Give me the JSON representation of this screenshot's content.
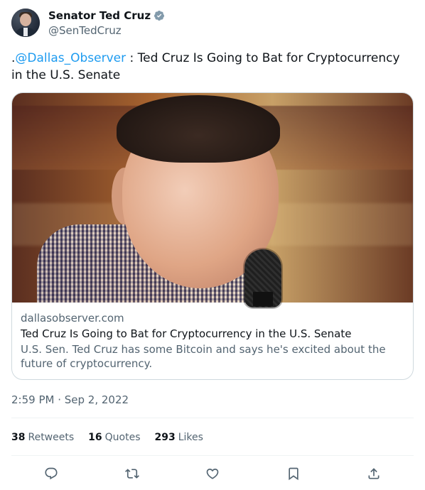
{
  "author": {
    "display_name": "Senator Ted Cruz",
    "handle": "@SenTedCruz",
    "verified_icon": "verified-badge"
  },
  "tweet": {
    "text_prefix": ".",
    "mention": "@Dallas_Observer",
    "text_rest": " : Ted Cruz Is Going to Bat for Cryptocurrency in the U.S. Senate"
  },
  "card": {
    "domain": "dallasobserver.com",
    "title": "Ted Cruz Is Going to Bat for Cryptocurrency in the U.S. Senate",
    "description": "U.S. Sen. Ted Cruz has some Bitcoin and says he's excited about the future of cryptocurrency."
  },
  "timestamp": "2:59 PM · Sep 2, 2022",
  "stats": {
    "retweets_count": "38",
    "retweets_label": "Retweets",
    "quotes_count": "16",
    "quotes_label": "Quotes",
    "likes_count": "293",
    "likes_label": "Likes"
  },
  "actions": [
    "reply-icon",
    "retweet-icon",
    "like-icon",
    "bookmark-icon",
    "share-icon"
  ],
  "colors": {
    "link": "#1d9bf0",
    "secondary_text": "#536471",
    "primary_text": "#0f1419",
    "border": "#cfd9de"
  }
}
